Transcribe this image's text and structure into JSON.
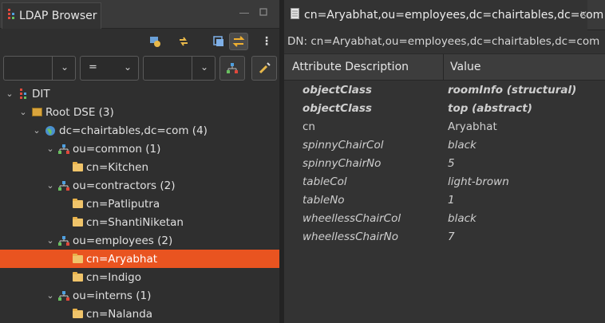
{
  "left_panel": {
    "tab_title": "LDAP Browser",
    "filter": {
      "attribute": "",
      "operator": "=",
      "value": ""
    },
    "tree": [
      {
        "label": "DIT",
        "level": 0,
        "expanded": true,
        "icon": "dit-icon"
      },
      {
        "label": "Root DSE (3)",
        "level": 1,
        "expanded": true,
        "icon": "root-dse-icon"
      },
      {
        "label": "dc=chairtables,dc=com (4)",
        "level": 2,
        "expanded": true,
        "icon": "globe-icon"
      },
      {
        "label": "ou=common (1)",
        "level": 3,
        "expanded": true,
        "icon": "org-unit-icon"
      },
      {
        "label": "cn=Kitchen",
        "level": 4,
        "icon": "folder-icon"
      },
      {
        "label": "ou=contractors (2)",
        "level": 3,
        "expanded": true,
        "icon": "org-unit-icon"
      },
      {
        "label": "cn=Patliputra",
        "level": 4,
        "icon": "folder-icon"
      },
      {
        "label": "cn=ShantiNiketan",
        "level": 4,
        "icon": "folder-icon"
      },
      {
        "label": "ou=employees (2)",
        "level": 3,
        "expanded": true,
        "icon": "org-unit-icon"
      },
      {
        "label": "cn=Aryabhat",
        "level": 4,
        "icon": "folder-icon",
        "selected": true
      },
      {
        "label": "cn=Indigo",
        "level": 4,
        "icon": "folder-icon"
      },
      {
        "label": "ou=interns (1)",
        "level": 3,
        "expanded": true,
        "icon": "org-unit-icon"
      },
      {
        "label": "cn=Nalanda",
        "level": 4,
        "icon": "folder-icon"
      }
    ]
  },
  "right_panel": {
    "tab_title": "cn=Aryabhat,ou=employees,dc=chairtables,dc=com",
    "dn_line": "DN: cn=Aryabhat,ou=employees,dc=chairtables,dc=com",
    "columns": [
      "Attribute Description",
      "Value"
    ],
    "rows": [
      {
        "attr": "objectClass",
        "value": "roomInfo (structural)",
        "style": "bold-italic"
      },
      {
        "attr": "objectClass",
        "value": "top (abstract)",
        "style": "bold-italic"
      },
      {
        "attr": "cn",
        "value": "Aryabhat",
        "style": "normal"
      },
      {
        "attr": "spinnyChairCol",
        "value": "black",
        "style": "italic"
      },
      {
        "attr": "spinnyChairNo",
        "value": "5",
        "style": "italic"
      },
      {
        "attr": "tableCol",
        "value": "light-brown",
        "style": "italic"
      },
      {
        "attr": "tableNo",
        "value": "1",
        "style": "italic"
      },
      {
        "attr": "wheellessChairCol",
        "value": "black",
        "style": "italic"
      },
      {
        "attr": "wheellessChairNo",
        "value": "7",
        "style": "italic"
      }
    ]
  },
  "colors": {
    "selection": "#e95420",
    "background": "#2f2f2f"
  }
}
